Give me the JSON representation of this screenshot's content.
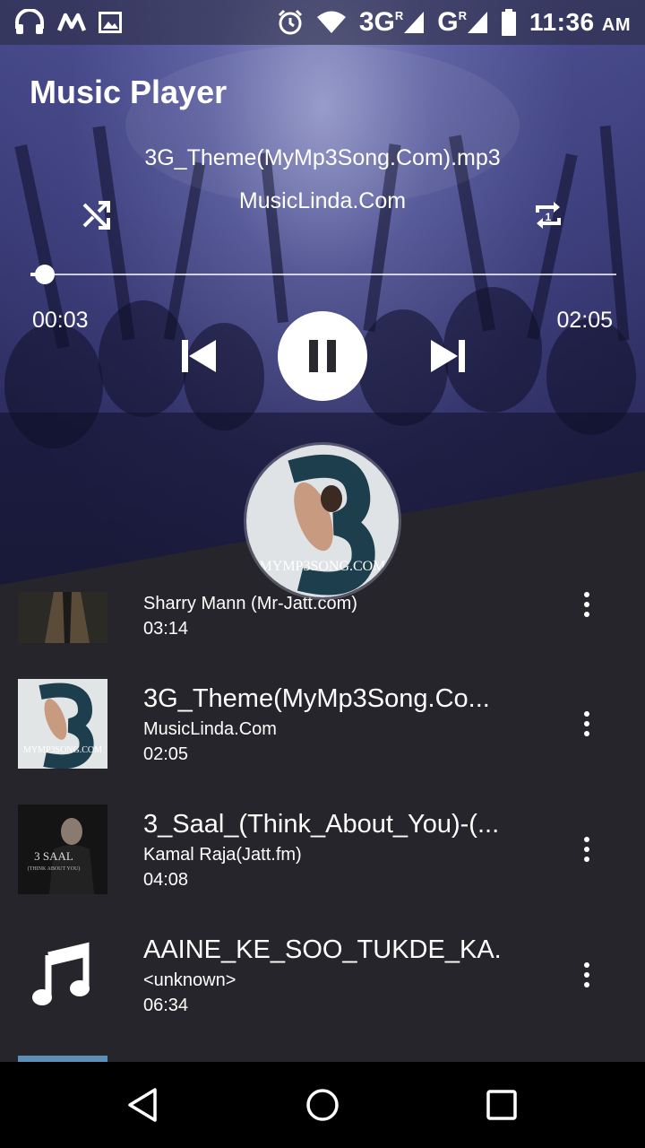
{
  "status_bar": {
    "time": "11:36",
    "ampm": "AM",
    "network_1": "3G",
    "network_2": "G",
    "roaming_mark": "R",
    "icons": [
      "headphones-icon",
      "m-app-icon",
      "image-icon",
      "alarm-icon",
      "wifi-icon",
      "signal-icon",
      "signal-icon",
      "battery-icon"
    ]
  },
  "app": {
    "title": "Music Player"
  },
  "now_playing": {
    "title": "3G_Theme(MyMp3Song.Com).mp3",
    "artist": "MusicLinda.Com",
    "elapsed": "00:03",
    "duration": "02:05",
    "progress": 0.024,
    "shuffle_icon": "shuffle-icon",
    "repeat_icon": "repeat-one-icon",
    "repeat_badge": "1",
    "album_art_text": "MYMP3SONG.COM"
  },
  "tracks": [
    {
      "name": "",
      "artist": "Sharry Mann (Mr-Jatt.com)",
      "duration": "03:14",
      "thumb": "album-art-suit"
    },
    {
      "name": "3G_Theme(MyMp3Song.Co...",
      "artist": "MusicLinda.Com",
      "duration": "02:05",
      "thumb": "album-art-3g",
      "thumb_text": "MYMP3SONG.COM"
    },
    {
      "name": "3_Saal_(Think_About_You)-(...",
      "artist": "Kamal Raja(Jatt.fm)",
      "duration": "04:08",
      "thumb": "album-art-3-saal",
      "thumb_text": "3 SAAL",
      "thumb_subtext": "(THINK ABOUT YOU)"
    },
    {
      "name": "AAINE_KE_SOO_TUKDE_KA...",
      "artist": "<unknown>",
      "duration": "06:34",
      "thumb": "music-note-icon"
    }
  ],
  "nav": [
    "back-icon",
    "home-icon",
    "recents-icon"
  ],
  "colors": {
    "hero": "#3d3f7c",
    "list_bg": "#26252b",
    "nav_bg": "#000000"
  }
}
